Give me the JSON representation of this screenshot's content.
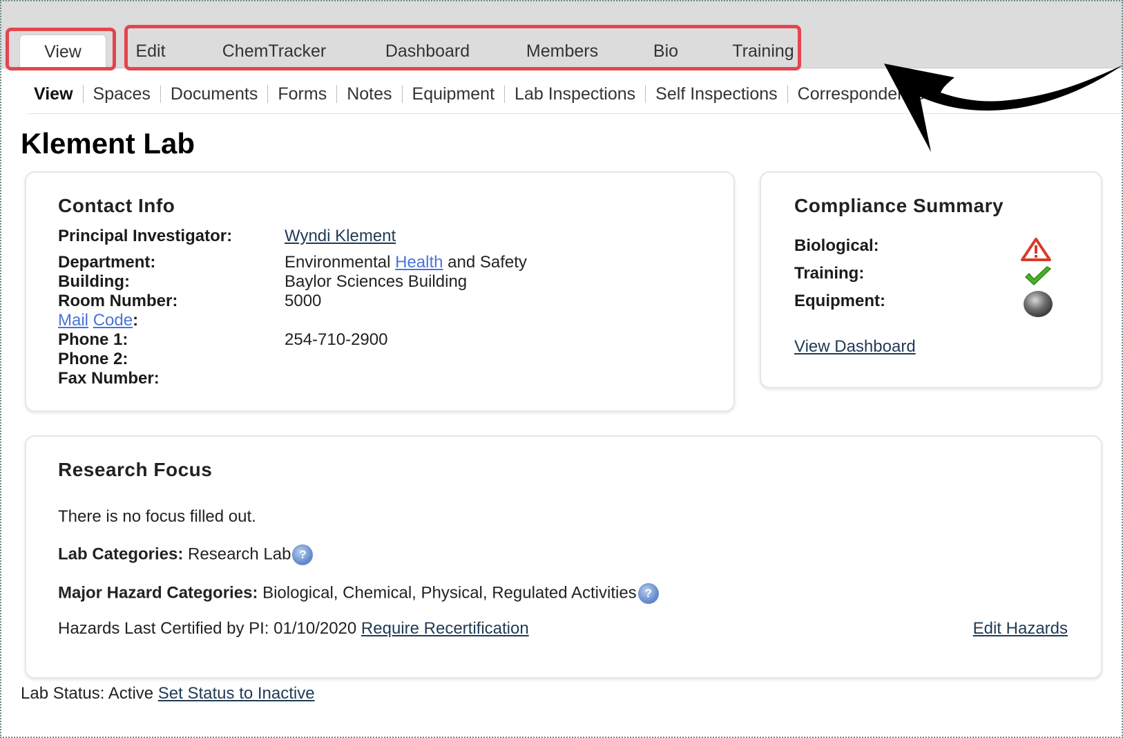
{
  "tabs": {
    "active": "View",
    "items": [
      "Edit",
      "ChemTracker",
      "Dashboard",
      "Members",
      "Bio",
      "Training"
    ]
  },
  "subnav": [
    "View",
    "Spaces",
    "Documents",
    "Forms",
    "Notes",
    "Equipment",
    "Lab Inspections",
    "Self Inspections",
    "Correspondence"
  ],
  "page": {
    "title": "Klement Lab"
  },
  "contact": {
    "title": "Contact Info",
    "pi_label": "Principal Investigator:",
    "pi_value": "Wyndi Klement",
    "dept_label": "Department:",
    "dept_value_1": "Environmental",
    "dept_value_link": "Health",
    "dept_value_2": "and Safety",
    "building_label": "Building:",
    "building_value": "Baylor Sciences Building",
    "room_label": "Room Number:",
    "room_value": "5000",
    "mail_label_1": "Mail",
    "mail_label_2": "Code",
    "phone1_label": "Phone 1:",
    "phone1_value": "254-710-2900",
    "phone2_label": "Phone 2:",
    "fax_label": "Fax Number:"
  },
  "compliance": {
    "title": "Compliance Summary",
    "rows": [
      {
        "label": "Biological:",
        "icon": "warning-icon"
      },
      {
        "label": "Training:",
        "icon": "check-icon"
      },
      {
        "label": "Equipment:",
        "icon": "gray-dot-icon"
      }
    ],
    "link": "View Dashboard"
  },
  "research": {
    "title": "Research Focus",
    "no_focus": "There is no focus filled out.",
    "lab_cat_label": "Lab Categories:",
    "lab_cat_value": "Research Lab",
    "hazard_label": "Major Hazard Categories:",
    "hazard_value": "Biological, Chemical, Physical, Regulated Activities",
    "certified_text": "Hazards Last Certified by PI: 01/10/2020",
    "recert_link": "Require Recertification",
    "edit_link": "Edit Hazards"
  },
  "status": {
    "text": "Lab Status: Active",
    "link": "Set Status to Inactive"
  },
  "colors": {
    "highlight": "#e4454f",
    "tabbar": "#dcdcdc",
    "link_blue": "#4a73d8"
  }
}
